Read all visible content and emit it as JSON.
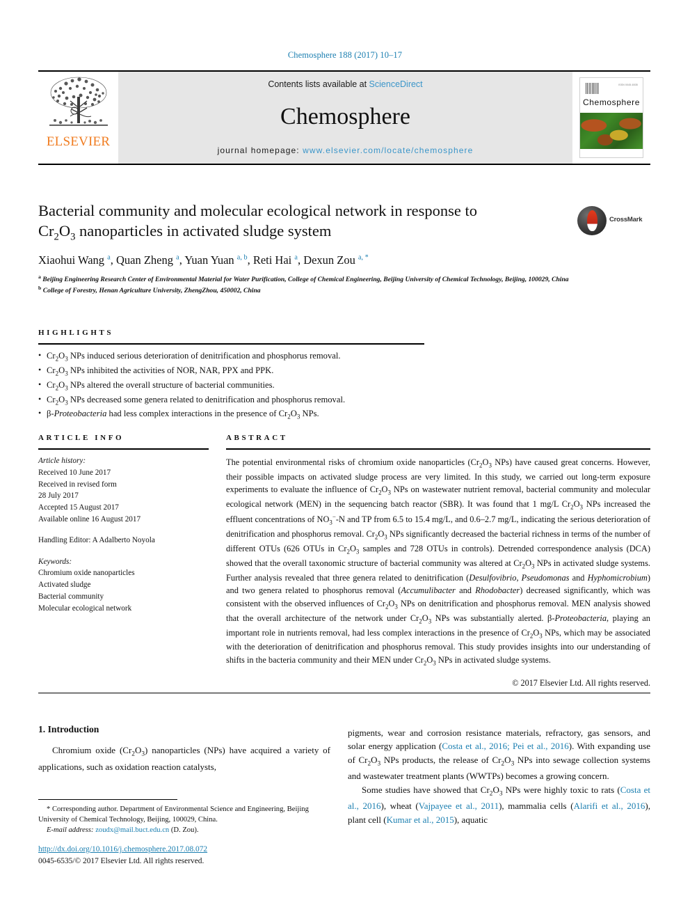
{
  "running_head": "Chemosphere 188 (2017) 10–17",
  "masthead": {
    "publisher": "ELSEVIER",
    "contents_prefix": "Contents lists available at ",
    "contents_link": "ScienceDirect",
    "journal_name": "Chemosphere",
    "homepage_prefix": "journal homepage: ",
    "homepage_url": "www.elsevier.com/locate/chemosphere",
    "cover_title": "Chemosphere",
    "cover_tag": "ISSN 0045-6535"
  },
  "article": {
    "title_line1": "Bacterial community and molecular ecological network in response to",
    "title_line2_pre": "Cr",
    "title_line2_sub1": "2",
    "title_line2_mid": "O",
    "title_line2_sub2": "3",
    "title_line2_post": " nanoparticles in activated sludge system",
    "crossmark_label": "CrossMark",
    "authors": "Xiaohui Wang a, Quan Zheng a, Yuan Yuan a, b, Reti Hai a, Dexun Zou a, *",
    "affiliation_a": "Beijing Engineering Research Center of Environmental Material for Water Purification, College of Chemical Engineering, Beijing University of Chemical Technology, Beijing, 100029, China",
    "affiliation_b": "College of Forestry, Henan Agriculture University, ZhengZhou, 450002, China"
  },
  "highlights": {
    "heading": "HIGHLIGHTS",
    "items": [
      "Cr2O3 NPs induced serious deterioration of denitrification and phosphorus removal.",
      "Cr2O3 NPs inhibited the activities of NOR, NAR, PPX and PPK.",
      "Cr2O3 NPs altered the overall structure of bacterial communities.",
      "Cr2O3 NPs decreased some genera related to denitrification and phosphorus removal.",
      "β-Proteobacteria had less complex interactions in the presence of Cr2O3 NPs."
    ]
  },
  "article_info": {
    "heading": "ARTICLE INFO",
    "history_label": "Article history:",
    "received": "Received 10 June 2017",
    "revised_label": "Received in revised form",
    "revised_date": "28 July 2017",
    "accepted": "Accepted 15 August 2017",
    "available": "Available online 16 August 2017",
    "handling_editor": "Handling Editor: A Adalberto Noyola",
    "keywords_label": "Keywords:",
    "keywords": [
      "Chromium oxide nanoparticles",
      "Activated sludge",
      "Bacterial community",
      "Molecular ecological network"
    ]
  },
  "abstract": {
    "heading": "ABSTRACT",
    "text": "The potential environmental risks of chromium oxide nanoparticles (Cr2O3 NPs) have caused great concerns. However, their possible impacts on activated sludge process are very limited. In this study, we carried out long-term exposure experiments to evaluate the influence of Cr2O3 NPs on wastewater nutrient removal, bacterial community and molecular ecological network (MEN) in the sequencing batch reactor (SBR). It was found that 1 mg/L Cr2O3 NPs increased the effluent concentrations of NO3−-N and TP from 6.5 to 15.4 mg/L, and 0.6–2.7 mg/L, indicating the serious deterioration of denitrification and phosphorus removal. Cr2O3 NPs significantly decreased the bacterial richness in terms of the number of different OTUs (626 OTUs in Cr2O3 samples and 728 OTUs in controls). Detrended correspondence analysis (DCA) showed that the overall taxonomic structure of bacterial community was altered at Cr2O3 NPs in activated sludge systems. Further analysis revealed that three genera related to denitrification (Desulfovibrio, Pseudomonas and Hyphomicrobium) and two genera related to phosphorus removal (Accumulibacter and Rhodobacter) decreased significantly, which was consistent with the observed influences of Cr2O3 NPs on denitrification and phosphorus removal. MEN analysis showed that the overall architecture of the network under Cr2O3 NPs was substantially alerted. β-Proteobacteria, playing an important role in nutrients removal, had less complex interactions in the presence of Cr2O3 NPs, which may be associated with the deterioration of denitrification and phosphorus removal. This study provides insights into our understanding of shifts in the bacteria community and their MEN under Cr2O3 NPs in activated sludge systems.",
    "copyright": "© 2017 Elsevier Ltd. All rights reserved."
  },
  "body": {
    "section_number_title": "1. Introduction",
    "left_paragraph": "Chromium oxide (Cr2O3) nanoparticles (NPs) have acquired a variety of applications, such as oxidation reaction catalysts,",
    "right_paragraph_1": "pigments, wear and corrosion resistance materials, refractory, gas sensors, and solar energy application (Costa et al., 2016; Pei et al., 2016). With expanding use of Cr2O3 NPs products, the release of Cr2O3 NPs into sewage collection systems and wastewater treatment plants (WWTPs) becomes a growing concern.",
    "right_paragraph_2": "Some studies have showed that Cr2O3 NPs were highly toxic to rats (Costa et al., 2016), wheat (Vajpayee et al., 2011), mammalia cells (Alarifi et al., 2016), plant cell (Kumar et al., 2015), aquatic"
  },
  "footnote": {
    "corresponding": "* Corresponding author. Department of Environmental Science and Engineering, Beijing University of Chemical Technology, Beijing, 100029, China.",
    "email_label": "E-mail address:",
    "email": "zoudx@mail.buct.edu.cn",
    "email_suffix": "(D. Zou).",
    "doi": "http://dx.doi.org/10.1016/j.chemosphere.2017.08.072",
    "issn_line": "0045-6535/© 2017 Elsevier Ltd. All rights reserved."
  },
  "colors": {
    "link": "#1a7eb0",
    "elsevier_orange": "#f07c20",
    "masthead_bg": "#e6e6e6",
    "sciencedirect": "#3a95c9"
  }
}
